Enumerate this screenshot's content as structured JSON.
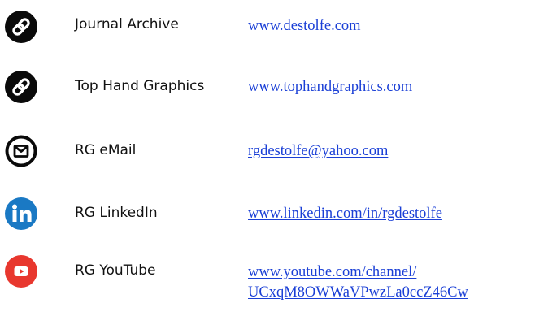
{
  "links": [
    {
      "label": "Journal Archive",
      "url_lines": [
        "www.destolfe.com"
      ],
      "icon": "link-icon",
      "icon_color": "#0a0a0a"
    },
    {
      "label": "Top Hand Graphics",
      "url_lines": [
        "www.tophandgraphics.com"
      ],
      "icon": "link-icon",
      "icon_color": "#0a0a0a"
    },
    {
      "label": "RG eMail",
      "url_lines": [
        "rgdestolfe@yahoo.com"
      ],
      "icon": "email-icon",
      "icon_color": "#0a0a0a"
    },
    {
      "label": "RG LinkedIn",
      "url_lines": [
        "www.linkedin.com/in/rgdestolfe"
      ],
      "icon": "linkedin-icon",
      "icon_color": "#1a79c4"
    },
    {
      "label": "RG YouTube",
      "url_lines": [
        "www.youtube.com/channel/",
        "UCxqM8OWWaVPwzLa0ccZ46Cw"
      ],
      "icon": "youtube-icon",
      "icon_color": "#e8372e"
    }
  ],
  "colors": {
    "link_text": "#1a3fd6",
    "label_text": "#111111"
  }
}
